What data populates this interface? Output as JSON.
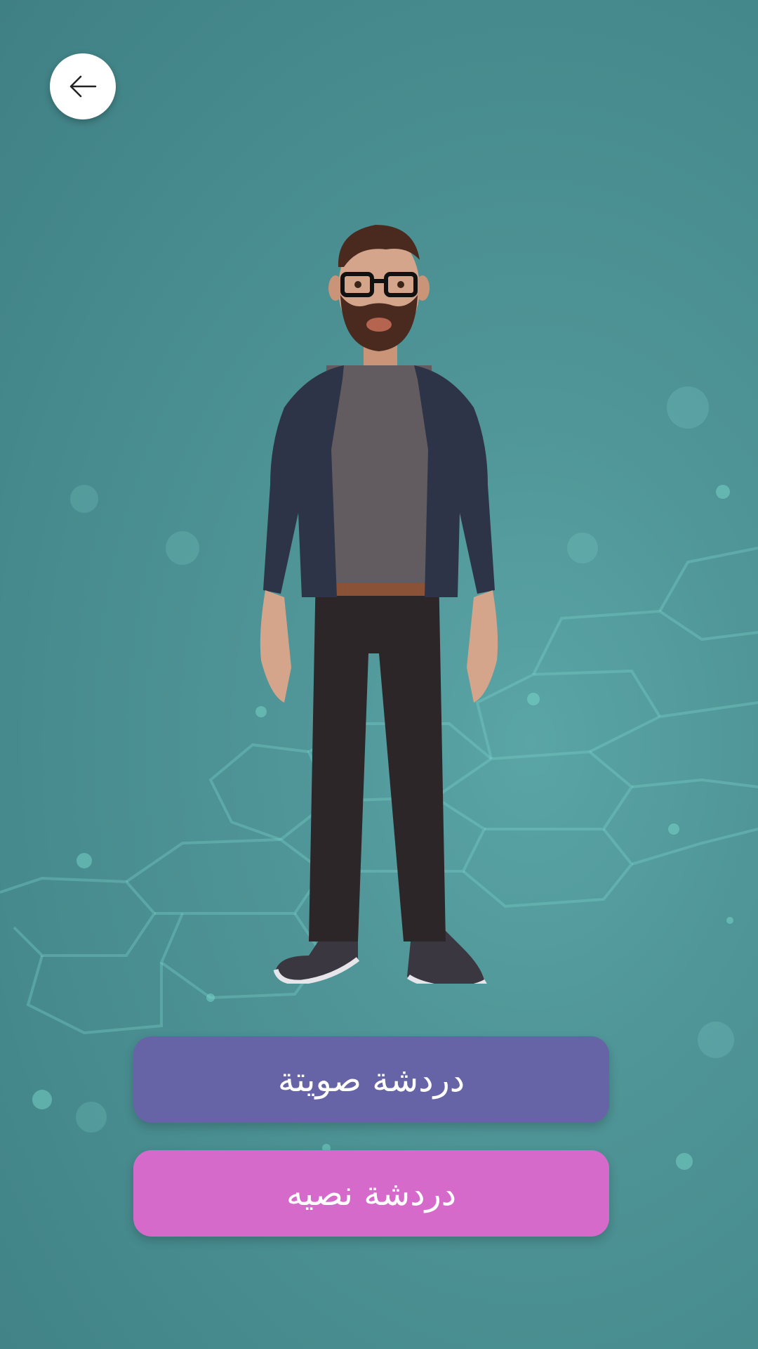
{
  "back_button": {
    "icon": "arrow-left-icon"
  },
  "avatar": {
    "description_icon": "avatar-figure"
  },
  "actions": {
    "voice_chat_label": "دردشة صويتة",
    "text_chat_label": "دردشة نصيه"
  },
  "colors": {
    "background": "#4f9496",
    "voice_button": "#6664a6",
    "text_button": "#d66acb",
    "label": "#ffffff"
  }
}
